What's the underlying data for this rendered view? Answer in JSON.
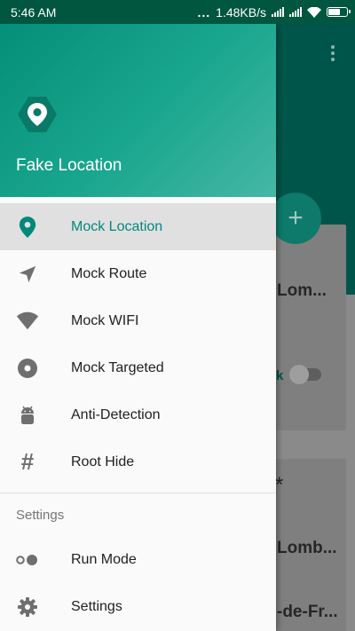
{
  "status_bar": {
    "time": "5:46 AM",
    "network_speed": "1.48KB/s",
    "dots": "..."
  },
  "background_app": {
    "card1_title_fragment": "Lom...",
    "card1_toggle_label_fragment": "k",
    "card2_symbol": "*",
    "card2_line1_fragment": "Lomb...",
    "card2_line2_fragment": "-de-Fr..."
  },
  "drawer": {
    "app_name": "Fake Location",
    "menu": [
      {
        "label": "Mock Location",
        "icon": "map-pin-icon",
        "active": true
      },
      {
        "label": "Mock Route",
        "icon": "navigation-arrow-icon",
        "active": false
      },
      {
        "label": "Mock WIFI",
        "icon": "wifi-icon",
        "active": false
      },
      {
        "label": "Mock Targeted",
        "icon": "target-disc-icon",
        "active": false
      },
      {
        "label": "Anti-Detection",
        "icon": "android-icon",
        "active": false
      },
      {
        "label": "Root Hide",
        "icon": "hash-icon",
        "active": false
      }
    ],
    "settings_section": {
      "title": "Settings",
      "items": [
        {
          "label": "Run Mode",
          "icon": "toggle-dots-icon"
        },
        {
          "label": "Settings",
          "icon": "gear-icon"
        }
      ]
    }
  },
  "colors": {
    "accent": "#00897b",
    "header_start": "#048f78",
    "header_end": "#46b7a6",
    "status_bar": "#00563f",
    "icon_gray": "#6f6f6f"
  }
}
